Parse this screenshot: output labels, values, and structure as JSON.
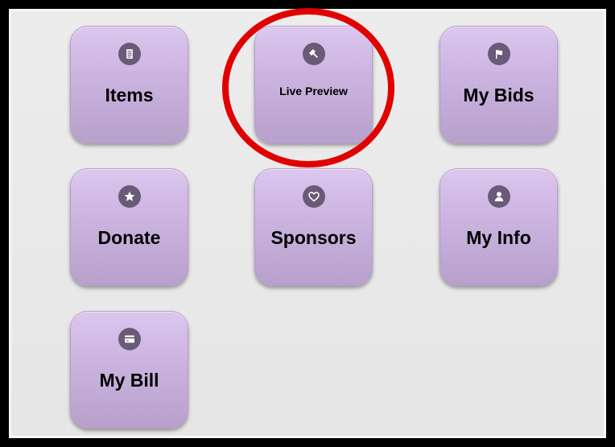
{
  "tiles": [
    {
      "label": "Items",
      "icon": "document-icon"
    },
    {
      "label": "Live Preview",
      "icon": "gavel-icon"
    },
    {
      "label": "My Bids",
      "icon": "flag-icon"
    },
    {
      "label": "Donate",
      "icon": "star-icon"
    },
    {
      "label": "Sponsors",
      "icon": "heart-icon"
    },
    {
      "label": "My Info",
      "icon": "user-icon"
    },
    {
      "label": "My Bill",
      "icon": "credit-card-icon"
    }
  ],
  "highlight": {
    "target": "Live Preview",
    "color": "#e00000"
  },
  "colors": {
    "tile_top": "#dcc7ef",
    "tile_bottom": "#b7a1cb",
    "icon_bg": "#6a5a78",
    "frame": "#000000",
    "background": "#e8e8e8"
  }
}
